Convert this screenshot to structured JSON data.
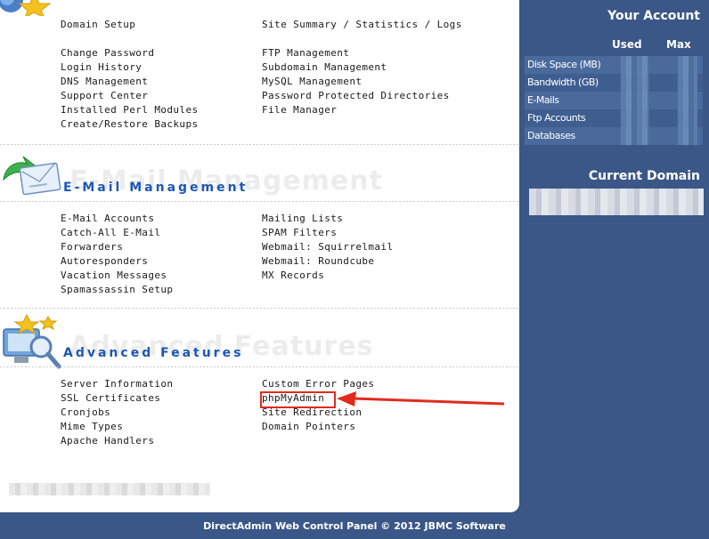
{
  "account_links": {
    "col1": [
      "Domain Setup",
      "",
      "Change Password",
      "Login History",
      "DNS Management",
      "Support Center",
      "Installed Perl Modules",
      "Create/Restore Backups"
    ],
    "col2": [
      "Site Summary / Statistics / Logs",
      "",
      "FTP Management",
      "Subdomain Management",
      "MySQL Management",
      "Password Protected Directories",
      "File Manager"
    ]
  },
  "email_section": {
    "title": "E-Mail Management",
    "ghost": "E-Mail Management",
    "col1": [
      "E-Mail Accounts",
      "Catch-All E-Mail",
      "Forwarders",
      "Autoresponders",
      "Vacation Messages",
      "Spamassassin Setup"
    ],
    "col2": [
      "Mailing Lists",
      "SPAM Filters",
      "Webmail: Squirrelmail",
      "Webmail: Roundcube",
      "MX Records"
    ]
  },
  "advanced_section": {
    "title": "Advanced Features",
    "ghost": "Advanced Features",
    "col1": [
      "Server Information",
      "SSL Certificates",
      "Cronjobs",
      "Mime Types",
      "Apache Handlers"
    ],
    "col2": [
      "Custom Error Pages",
      "phpMyAdmin",
      "Site Redirection",
      "Domain Pointers"
    ]
  },
  "sidebar": {
    "your_account": "Your Account",
    "used": "Used",
    "max": "Max",
    "rows": [
      "Disk Space (MB)",
      "Bandwidth (GB)",
      "E-Mails",
      "Ftp Accounts",
      "Databases"
    ],
    "current_domain": "Current Domain"
  },
  "footer": "DirectAdmin Web Control Panel © 2012 JBMC Software",
  "colors": {
    "sidebar_bg": "#3a5787",
    "section_title": "#1d57b5",
    "highlight": "#e02b1e"
  }
}
